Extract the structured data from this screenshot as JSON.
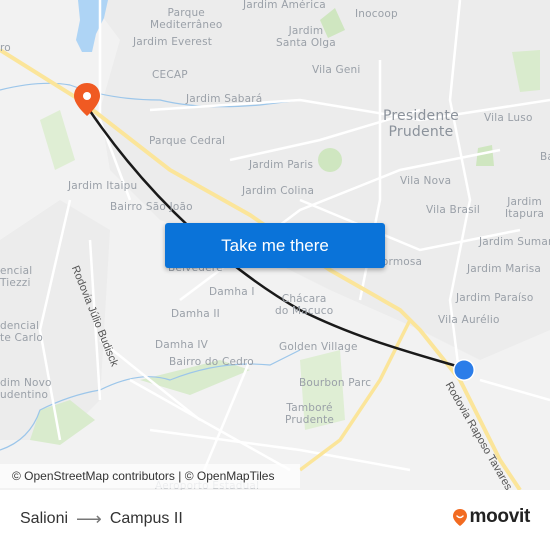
{
  "map": {
    "labels": {
      "parque_mediterraneo": "Parque\nMediterrâneo",
      "jardim_america": "Jardim América",
      "inocoop": "Inocoop",
      "jardim_everest": "Jardim Everest",
      "jardim_santa_olga": "Jardim\nSanta Olga",
      "cecap": "CECAP",
      "vila_geni": "Vila Geni",
      "jardim_sabara": "Jardim Sabará",
      "presidente_prudente": "Presidente\nPrudente",
      "vila_luso": "Vila Luso",
      "parque_cedral": "Parque Cedral",
      "jardim_paris": "Jardim Paris",
      "jardim_colina": "Jardim Colina",
      "vila_nova": "Vila Nova",
      "jardim_itaipu": "Jardim Itaipu",
      "bairro_sao_joao": "Bairro São João",
      "vila_brasil": "Vila Brasil",
      "jardim_itapura": "Jardim\nItapura",
      "ba": "Ba",
      "jardim_sumare": "Jardim Sumaré",
      "belvedere": "Belvedere",
      "formosa": "Formosa",
      "jardim_marisa": "Jardim Marisa",
      "residencial_tiezzi": "encial\nTiezzi",
      "damha_i": "Damha I",
      "jardim_paraiso": "Jardim Paraíso",
      "chacara_do_macuco": "Chácara\ndo Macuco",
      "damha_ii": "Damha II",
      "vila_aurelio": "Vila Aurélio",
      "residencial_monte_carlo": "dencial\nte Carlo",
      "damha_iv": "Damha IV",
      "golden_village": "Golden Village",
      "bairro_do_cedro": "Bairro do Cedro",
      "jardim_novo_prudentino": "dim Novo\nudentino",
      "bourbon_parc": "Bourbon Parc",
      "tambore_prudente": "Tamboré\nPrudente",
      "aeroporto_estadual": "Aeroporto Estadual",
      "edge_ro": "ro"
    },
    "roads": {
      "rodovia_julio_budisck": "Rodovia Júlio Budisck",
      "rodovia_raposo_tavares": "Rodovia Raposo Tavares"
    },
    "origin_marker_color": "#f05a22",
    "destination_marker_color": "#2b7de9",
    "route_color": "#1a1a1a"
  },
  "cta": {
    "label": "Take me there",
    "color": "#0a73d9"
  },
  "attribution": "© OpenStreetMap contributors | © OpenMapTiles",
  "route": {
    "from": "Salioni",
    "arrow": "⟶",
    "to": "Campus II"
  },
  "brand": {
    "name": "moovit",
    "color": "#f26b21"
  }
}
